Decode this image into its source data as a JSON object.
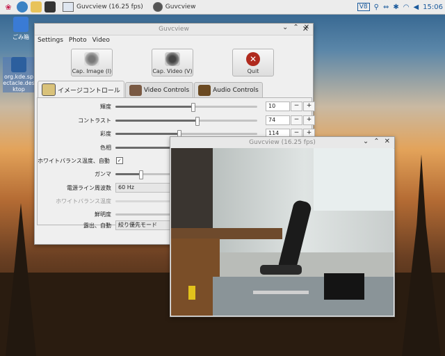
{
  "taskbar": {
    "task1": "Guvcview  (16.25 fps)",
    "task2": "Guvcview",
    "tray_ve": "V8",
    "clock": "15:06"
  },
  "desktop": {
    "trash_label": "ごみ箱",
    "file_label": "org.kde.spectacle.desktop"
  },
  "main_window": {
    "title": "Guvcview",
    "menu": [
      "Settings",
      "Photo",
      "Video"
    ],
    "buttons": {
      "cap_image": "Cap. Image (I)",
      "cap_video": "Cap. Video (V)",
      "quit": "Quit"
    },
    "tabs": {
      "image": "イメージコントロール",
      "video": "Video Controls",
      "audio": "Audio Controls"
    },
    "controls": {
      "brightness": {
        "label": "輝度",
        "value": "10",
        "level": 0.55
      },
      "contrast": {
        "label": "コントラスト",
        "value": "74",
        "level": 0.58
      },
      "saturation": {
        "label": "彩度",
        "value": "114",
        "level": 0.45
      },
      "hue": {
        "label": "色相",
        "level": 0.5
      },
      "wb_auto": {
        "label": "ホワイトバランス温度、自動"
      },
      "gamma": {
        "label": "ガンマ",
        "level": 0.18
      },
      "powerline": {
        "label": "電源ライン周波数",
        "value": "60 Hz"
      },
      "wb_temp": {
        "label": "ホワイトバランス温度"
      },
      "sharpness": {
        "label": "鮮明度"
      },
      "exposure": {
        "label": "露出、自動",
        "value": "絞り優先モード"
      }
    }
  },
  "video_window": {
    "title": "Guvcview  (16.25 fps)"
  },
  "colors": {
    "quit_red": "#b02a1e",
    "title_gray": "#888888"
  }
}
